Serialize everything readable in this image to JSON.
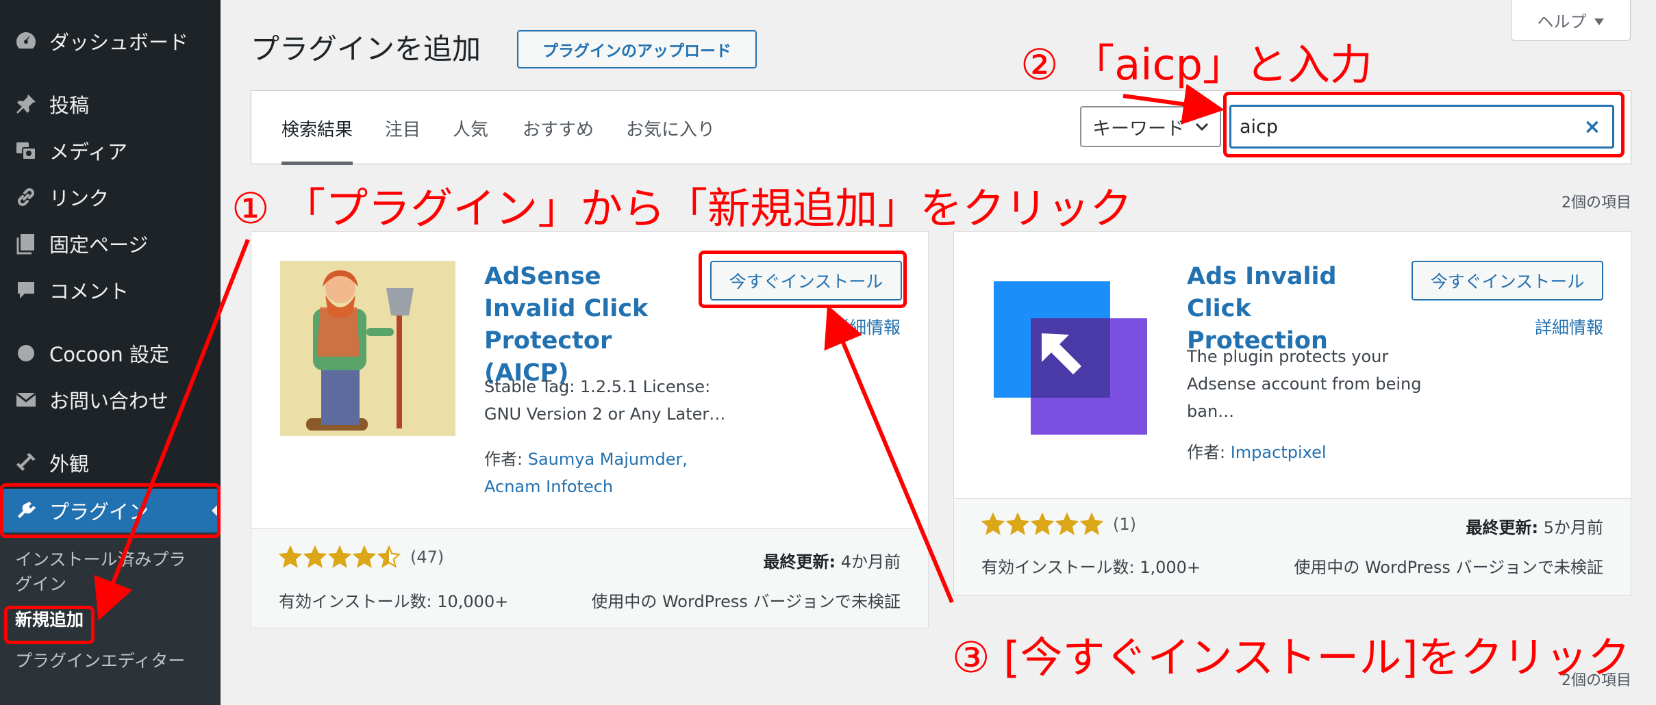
{
  "sidebar": {
    "items": [
      {
        "label": "ダッシュボード",
        "icon": "dashboard-icon"
      },
      {
        "label": "投稿",
        "icon": "pin-icon"
      },
      {
        "label": "メディア",
        "icon": "media-icon"
      },
      {
        "label": "リンク",
        "icon": "link-icon"
      },
      {
        "label": "固定ページ",
        "icon": "pages-icon"
      },
      {
        "label": "コメント",
        "icon": "comment-icon"
      },
      {
        "label": "Cocoon 設定",
        "icon": "circle-icon"
      },
      {
        "label": "お問い合わせ",
        "icon": "mail-icon"
      },
      {
        "label": "外観",
        "icon": "appearance-icon"
      },
      {
        "label": "プラグイン",
        "icon": "plugin-icon"
      }
    ],
    "submenu": [
      {
        "label": "インストール済みプラ\nグイン"
      },
      {
        "label": "新規追加"
      },
      {
        "label": "プラグインエディター"
      }
    ]
  },
  "header": {
    "title": "プラグインを追加",
    "upload_label": "プラグインのアップロード",
    "help_label": "ヘルプ"
  },
  "filter": {
    "tabs": [
      "検索結果",
      "注目",
      "人気",
      "おすすめ",
      "お気に入り"
    ],
    "search_type": "キーワード",
    "search_value": "aicp",
    "item_count": "2個の項目",
    "item_count_bottom": "2個の項目"
  },
  "plugins": [
    {
      "name": "AdSense Invalid Click Protector (AICP)",
      "install_label": "今すぐインストール",
      "more_label": "詳細情報",
      "description": "Stable Tag: 1.2.5.1 License: GNU Version 2 or Any Later…",
      "author_prefix": "作者: ",
      "author": "Saumya Majumder, Acnam Infotech",
      "rating": 4.5,
      "rating_count": "(47)",
      "last_updated_label": "最終更新:",
      "last_updated": " 4か月前",
      "installs": "有効インストール数: 10,000+",
      "compat": "使用中の WordPress バージョンで未検証"
    },
    {
      "name": "Ads Invalid Click Protection",
      "install_label": "今すぐインストール",
      "more_label": "詳細情報",
      "description": "The plugin protects your Adsense account from being ban…",
      "author_prefix": "作者: ",
      "author": "Impactpixel",
      "rating": 5,
      "rating_count": "(1)",
      "last_updated_label": "最終更新:",
      "last_updated": " 5か月前",
      "installs": "有効インストール数: 1,000+",
      "compat": "使用中の WordPress バージョンで未検証"
    }
  ],
  "annotations": {
    "step1": "① 「プラグイン」から「新規追加」をクリック",
    "step2": "② 「aicp」と入力",
    "step3": "③ [今すぐインストール]をクリック"
  },
  "colors": {
    "annotation": "#ff0000",
    "accent": "#2271b1",
    "star": "#dba617",
    "sidebar": "#1d2327"
  }
}
